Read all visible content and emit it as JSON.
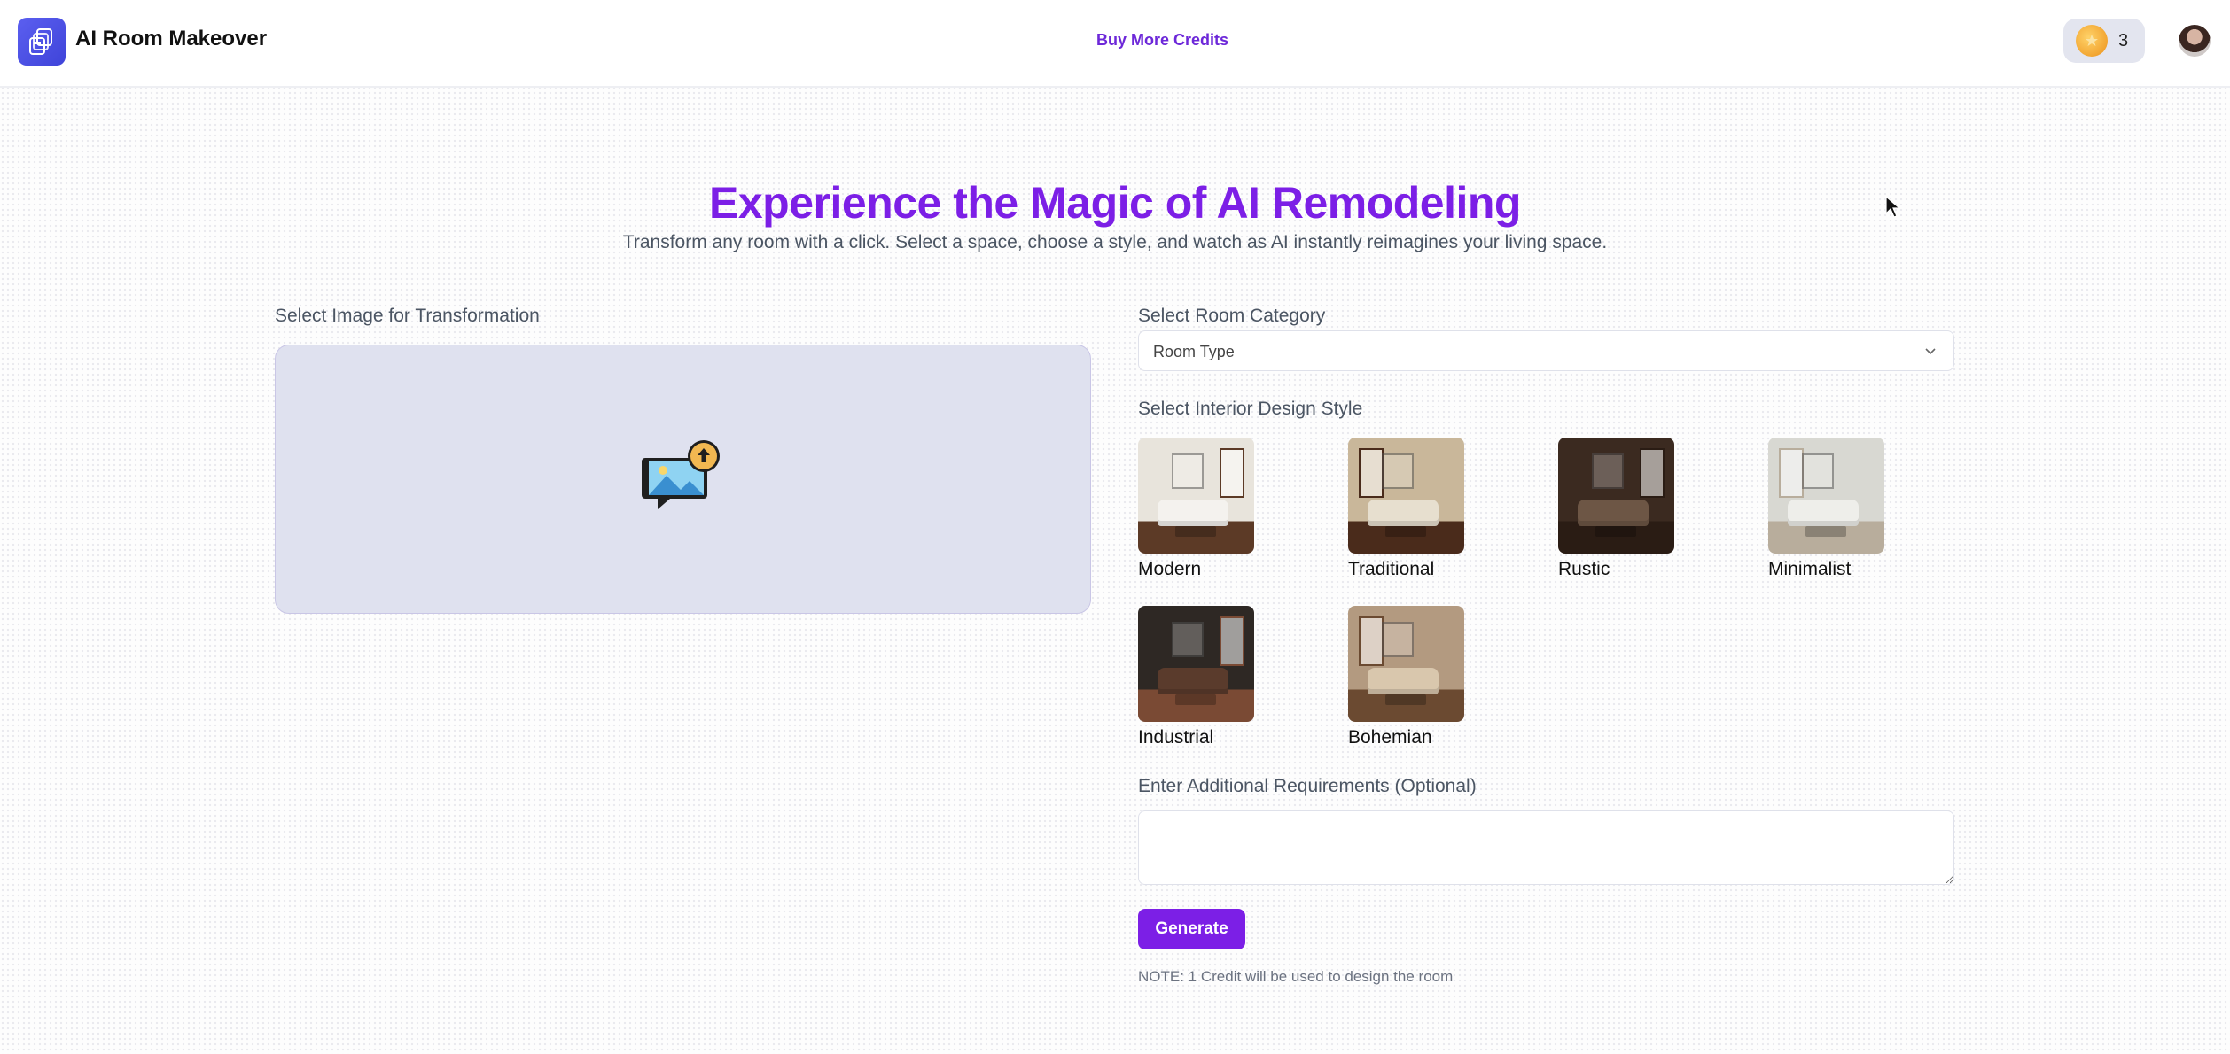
{
  "app": {
    "title": "AI Room Makeover",
    "buy_credits": "Buy More Credits",
    "credits": "3",
    "accent": "#7c1fe6",
    "logo_color": "#4a4fe0"
  },
  "hero": {
    "title": "Experience the Magic of AI Remodeling",
    "subtitle": "Transform any room with a click. Select a space, choose a style, and watch as AI instantly reimagines your living space."
  },
  "upload": {
    "label": "Select Image for Transformation",
    "icon": "image-upload-icon"
  },
  "room": {
    "label": "Select Room Category",
    "selected": "Room Type"
  },
  "styles": {
    "label": "Select Interior Design Style",
    "items": [
      {
        "name": "Modern",
        "palette": [
          "#e8e4dc",
          "#f4f2ee",
          "#5c3a26"
        ]
      },
      {
        "name": "Traditional",
        "palette": [
          "#c9b79a",
          "#e7dfcf",
          "#4a2b1b"
        ]
      },
      {
        "name": "Rustic",
        "palette": [
          "#3b2a20",
          "#6d5645",
          "#2a1c14"
        ]
      },
      {
        "name": "Minimalist",
        "palette": [
          "#d8d8d2",
          "#eeeeea",
          "#b8ad9c"
        ]
      },
      {
        "name": "Industrial",
        "palette": [
          "#2e2824",
          "#5a3b2c",
          "#7a4a34"
        ]
      },
      {
        "name": "Bohemian",
        "palette": [
          "#b39a80",
          "#d9c7ad",
          "#6b4a31"
        ]
      }
    ]
  },
  "requirements": {
    "label": "Enter Additional Requirements (Optional)",
    "value": ""
  },
  "actions": {
    "generate": "Generate",
    "note": "NOTE: 1 Credit will be used to design the room"
  }
}
